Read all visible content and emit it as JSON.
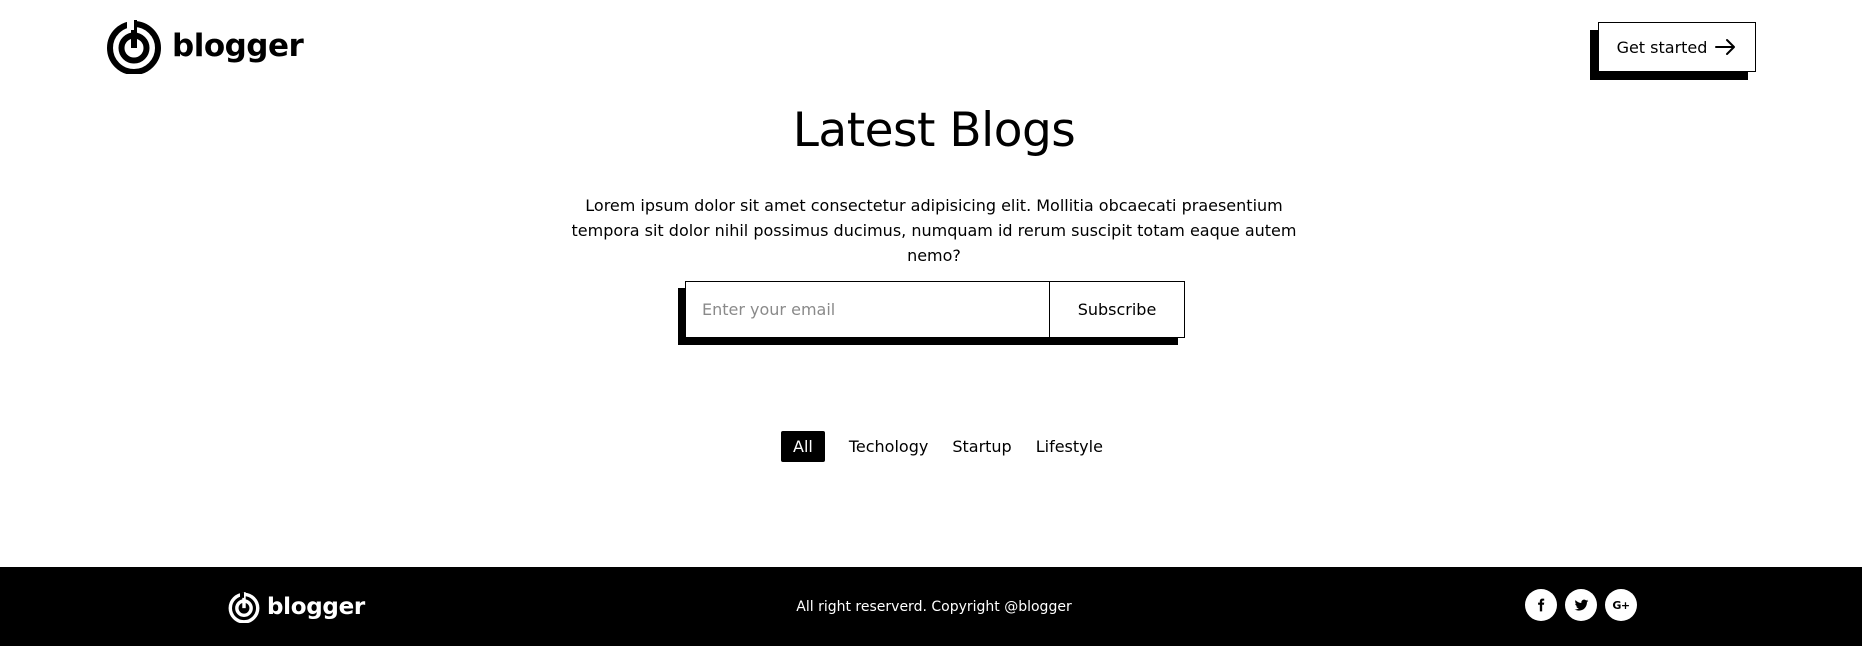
{
  "header": {
    "logo_text": "blogger",
    "cta_label": "Get started"
  },
  "hero": {
    "title": "Latest Blogs",
    "description": "Lorem ipsum dolor sit amet consectetur adipisicing elit. Mollitia obcaecati praesentium tempora sit dolor nihil possimus ducimus, numquam id rerum suscipit totam eaque autem nemo?"
  },
  "subscribe": {
    "email_placeholder": "Enter your email",
    "email_value": "",
    "button_label": "Subscribe"
  },
  "filters": {
    "items": [
      {
        "label": "All",
        "active": true
      },
      {
        "label": "Techology",
        "active": false
      },
      {
        "label": "Startup",
        "active": false
      },
      {
        "label": "Lifestyle",
        "active": false
      }
    ]
  },
  "footer": {
    "logo_text": "blogger",
    "copyright": "All right reserverd. Copyright @blogger",
    "socials": [
      "facebook-icon",
      "twitter-icon",
      "google-plus-icon"
    ],
    "gplus_glyph": "G+"
  },
  "colors": {
    "primary": "#000000",
    "background": "#ffffff",
    "placeholder": "#8a8a8a"
  }
}
